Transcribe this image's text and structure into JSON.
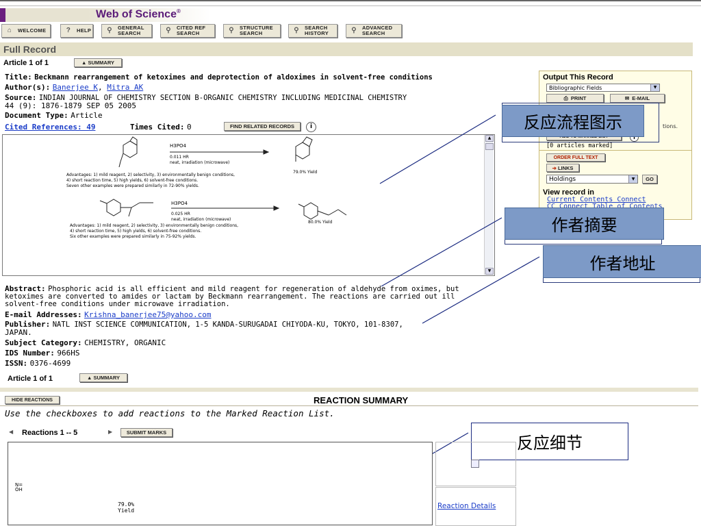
{
  "header": {
    "logo": "Web of Science",
    "logo_mark": "®"
  },
  "toolbar": [
    {
      "label": "WELCOME"
    },
    {
      "label": "HELP"
    },
    {
      "label": "GENERAL SEARCH"
    },
    {
      "label": "CITED REF SEARCH"
    },
    {
      "label": "STRUCTURE SEARCH"
    },
    {
      "label": "SEARCH HISTORY"
    },
    {
      "label": "ADVANCED SEARCH"
    }
  ],
  "section_title": "Full Record",
  "article_nav": {
    "text": "Article 1 of 1",
    "summary_btn": "SUMMARY"
  },
  "record": {
    "title_label": "Title:",
    "title": "Beckmann rearrangement of ketoximes and deprotection of aldoximes in solvent-free conditions",
    "authors_label": "Author(s):",
    "author1": "Banerjee K",
    "author2": "Mitra AK",
    "source_label": "Source:",
    "source": "INDIAN JOURNAL OF CHEMISTRY SECTION B-ORGANIC CHEMISTRY INCLUDING MEDICINAL CHEMISTRY",
    "source2": "44 (9): 1876-1879 SEP 05 2005",
    "doctype_label": "Document Type:",
    "doctype": "Article",
    "cited_refs": "Cited References: 49",
    "times_cited_label": "Times Cited:",
    "times_cited": "0",
    "find_related": "FIND RELATED RECORDS"
  },
  "scheme": {
    "r1_reagent": "H3PO4",
    "r1_time": "0.011 HR",
    "r1_cond": "neat, irradiation (microwave)",
    "r1_yield": "79.0% Yield",
    "r1_adv1": "Advantages: 1) mild reagent, 2) selectivity, 3) environmentally benign conditions,",
    "r1_adv2": "4) short reaction time, 5) high yields, 6) solvent-free conditions.",
    "r1_adv3": "Seven other examples were prepared similarly in 72-90% yields.",
    "r2_reagent": "H3PO4",
    "r2_time": "0.025 HR",
    "r2_cond": "neat, irradiation (microwave)",
    "r2_yield": "80.0% Yield",
    "r2_adv1": "Advantages: 1) mild reagent, 2) selectivity, 3) environmentally benign conditions,",
    "r2_adv2": "4) short reaction time, 5) high yields, 6) solvent-free conditions.",
    "r2_adv3": "Six other examples were prepared similarly in 75-92% yields."
  },
  "abstract": {
    "label": "Abstract:",
    "l1": "Phosphoric acid is all efficient and mild reagent for regeneration of aldehyde from oximes, but",
    "l2": "ketoximes are converted to amides or lactam by Beckmann rearrangement. The reactions are carried out ill",
    "l3": "solvent-free conditions under microwave irradiation."
  },
  "email": {
    "label": "E-mail Addresses:",
    "value": "Krishna_banerjee75@yahoo.com"
  },
  "publisher": {
    "label": "Publisher:",
    "l1": "NATL INST SCIENCE COMMUNICATION, 1-5 KANDA-SURUGADAI CHIYODA-KU, TOKYO, 101-8307,",
    "l2": "JAPAN."
  },
  "subject": {
    "label": "Subject Category:",
    "value": "CHEMISTRY, ORGANIC"
  },
  "ids": {
    "label": "IDS Number:",
    "value": "966HS"
  },
  "issn": {
    "label": "ISSN:",
    "value": "0376-4699"
  },
  "article_nav2": {
    "text": "Article 1 of 1",
    "summary_btn": "SUMMARY"
  },
  "output_panel": {
    "title": "Output This Record",
    "select": "Bibliographic Fields",
    "print": "PRINT",
    "email": "E-MAIL",
    "partial": "tions.",
    "add_marked": "ADD TO MARKED LIST",
    "marked_count": "[0 articles marked]",
    "order_full_text": "ORDER FULL TEXT",
    "links": "LINKS",
    "holdings": "Holdings",
    "go": "GO",
    "view_record_in": "View record in",
    "ccc": "Current Contents Connect",
    "cc_toc": "CC Connect Table of Contents"
  },
  "reaction_summary": {
    "hide_btn": "HIDE REACTIONS",
    "title": "REACTION SUMMARY",
    "instruction": "Use the checkboxes to add reactions to the Marked Reaction List.",
    "range": "Reactions 1 -- 5",
    "submit": "SUBMIT MARKS",
    "yield": "79.0%",
    "yield_word": "Yield",
    "details_link": "Reaction Details"
  },
  "callouts": [
    {
      "text": "反应流程图示"
    },
    {
      "text": "作者摘要"
    },
    {
      "text": "作者地址"
    },
    {
      "text": "反应细节"
    }
  ],
  "colors": {
    "brand": "#5a1a78",
    "link": "#1a3cc8",
    "callout": "#7d9ac7",
    "panel": "#fffde6"
  }
}
